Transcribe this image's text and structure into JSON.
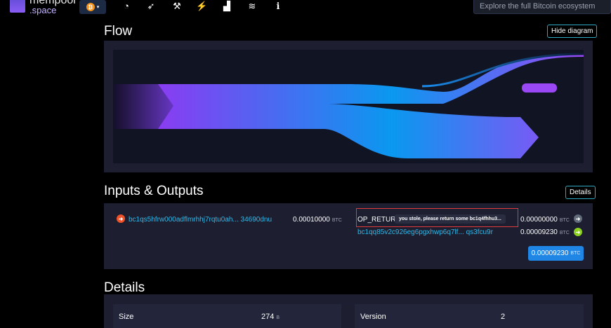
{
  "brand": {
    "line1": "mempool",
    "line2": ".space"
  },
  "network": {
    "symbol": "₿",
    "caret": "▾"
  },
  "nav_icons": [
    {
      "name": "dashboard-gauge-icon",
      "glyph": "◔"
    },
    {
      "name": "rocket-icon",
      "glyph": "➶"
    },
    {
      "name": "pickaxe-icon",
      "glyph": "⚒"
    },
    {
      "name": "lightning-icon",
      "glyph": "⚡"
    },
    {
      "name": "chart-icon",
      "glyph": "▟"
    },
    {
      "name": "layers-icon",
      "glyph": "≋"
    },
    {
      "name": "info-icon",
      "glyph": "ℹ"
    }
  ],
  "search": {
    "placeholder": "Explore the full Bitcoin ecosystem"
  },
  "flow": {
    "title": "Flow",
    "hide_button": "Hide diagram"
  },
  "io": {
    "title": "Inputs & Outputs",
    "details_button": "Details",
    "input": {
      "address": "bc1qs5hfrw000adflmrhhj7rqtu0ah... 34690dnu",
      "amount": "0.00010000",
      "unit": "BTC"
    },
    "outputs": [
      {
        "label": "OP_RETURN",
        "message": "you stole, please return some bc1q4fhhu3...",
        "amount": "0.00000000",
        "unit": "BTC"
      },
      {
        "address": "bc1qq85v2c926eg6pgxhwp6q7lf... qs3fcu9r",
        "amount": "0.00009230",
        "unit": "BTC"
      }
    ],
    "total": {
      "amount": "0.00009230",
      "unit": "BTC"
    }
  },
  "details": {
    "title": "Details",
    "size_label": "Size",
    "size_value": "274",
    "size_unit": "B",
    "version_label": "Version",
    "version_value": "2"
  },
  "colors": {
    "accent": "#2fb8e8",
    "primary_btn": "#1f86e6",
    "highlight_box": "#e23b3b",
    "input_arrow": "#f0522a",
    "output_arrow_spent": "#616b7a",
    "output_arrow_unspent": "#8cd11f"
  }
}
